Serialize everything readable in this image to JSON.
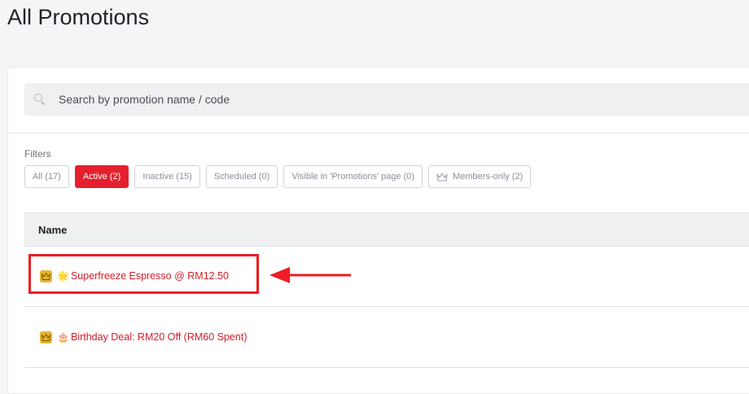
{
  "page": {
    "title": "All Promotions"
  },
  "search": {
    "placeholder": "Search by promotion name / code"
  },
  "filters": {
    "label": "Filters",
    "chips": [
      {
        "label": "All (17)",
        "active": false
      },
      {
        "label": "Active (2)",
        "active": true
      },
      {
        "label": "Inactive (15)",
        "active": false
      },
      {
        "label": "Scheduled (0)",
        "active": false
      },
      {
        "label": "Visible in 'Promotions' page (0)",
        "active": false
      },
      {
        "label": "Members-only (2)",
        "active": false,
        "icon": "crown-outline-icon"
      }
    ]
  },
  "table": {
    "header": "Name",
    "rows": [
      {
        "badge": "crown-icon",
        "emoji": "🌟",
        "name": "Superfreeze Espresso @ RM12.50"
      },
      {
        "badge": "crown-icon",
        "emoji": "🎂",
        "name": "Birthday Deal: RM20 Off (RM60 Spent)"
      }
    ]
  },
  "annotation": {
    "color": "#ee1c24",
    "target_row": 0
  },
  "colors": {
    "accent": "#e5202e",
    "link": "#d21d2a",
    "crown": "#e7b431"
  }
}
